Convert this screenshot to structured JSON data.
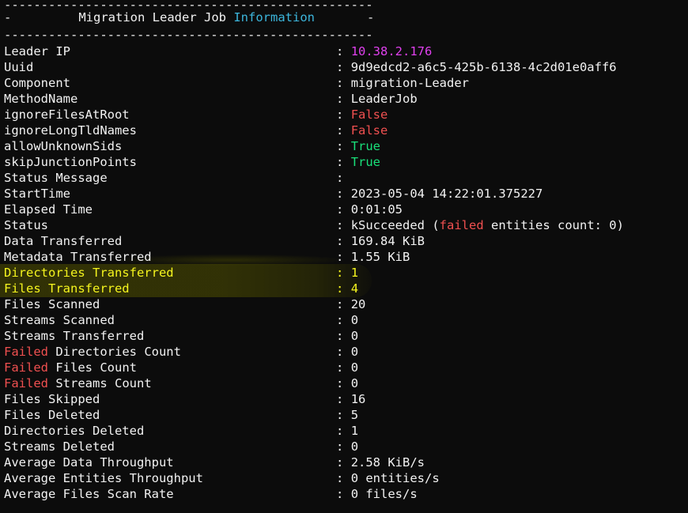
{
  "colors": {
    "text": "#f2f2f2",
    "background": "#0c0c0c",
    "cyan": "#3cb6dc",
    "magenta": "#e040ee",
    "red": "#f05050",
    "green": "#19e07a",
    "yellow": "#f5f51e"
  },
  "header": {
    "rule": "--------------------------------------------------",
    "left_dash": "-",
    "title_part1": "Migration Leader Job",
    "title_part2": "Information",
    "right_dash": "-"
  },
  "separator": ":",
  "rows": [
    {
      "key": "Leader IP",
      "value": "10.38.2.176",
      "value_color": "magenta"
    },
    {
      "key": "Uuid",
      "value": "9d9edcd2-a6c5-425b-6138-4c2d01e0aff6"
    },
    {
      "key": "Component",
      "value": "migration-Leader"
    },
    {
      "key": "MethodName",
      "value": "LeaderJob"
    },
    {
      "key": "ignoreFilesAtRoot",
      "value": "False",
      "value_color": "red"
    },
    {
      "key": "ignoreLongTldNames",
      "value": "False",
      "value_color": "red"
    },
    {
      "key": "allowUnknownSids",
      "value": "True",
      "value_color": "green"
    },
    {
      "key": "skipJunctionPoints",
      "value": "True",
      "value_color": "green"
    },
    {
      "key": "Status Message",
      "value": ""
    },
    {
      "key": "StartTime",
      "value": "2023-05-04 14:22:01.375227"
    },
    {
      "key": "Elapsed Time",
      "value": "0:01:05"
    },
    {
      "key": "Status",
      "value_parts": [
        "kSucceeded (",
        "failed",
        " entities count: 0)"
      ]
    },
    {
      "key": "Data Transferred",
      "value": "169.84 KiB"
    },
    {
      "key": "Metadata Transferred",
      "value": "1.55 KiB"
    },
    {
      "key": "Directories Transferred",
      "value": "1",
      "color": "yellow"
    },
    {
      "key": "Files Transferred",
      "value": "4",
      "color": "yellow"
    },
    {
      "key": "Files Scanned",
      "value": "20"
    },
    {
      "key": "Streams Scanned",
      "value": "0"
    },
    {
      "key": "Streams Transferred",
      "value": "0"
    },
    {
      "key_parts": [
        "Failed",
        " Directories Count"
      ],
      "value": "0"
    },
    {
      "key_parts": [
        "Failed",
        " Files Count"
      ],
      "value": "0"
    },
    {
      "key_parts": [
        "Failed",
        " Streams Count"
      ],
      "value": "0"
    },
    {
      "key": "Files Skipped",
      "value": "16"
    },
    {
      "key": "Files Deleted",
      "value": "5"
    },
    {
      "key": "Directories Deleted",
      "value": "1"
    },
    {
      "key": "Streams Deleted",
      "value": "0"
    },
    {
      "key": "Average Data Throughput",
      "value": "2.58 KiB/s"
    },
    {
      "key": "Average Entities Throughput",
      "value": "0 entities/s"
    },
    {
      "key": "Average Files Scan Rate",
      "value": "0 files/s"
    }
  ]
}
